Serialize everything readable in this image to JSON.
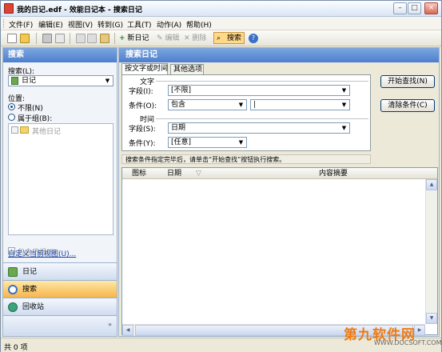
{
  "window": {
    "title": "我的日记.edf - 效能日记本 - 搜索日记"
  },
  "menu": [
    "文件(F)",
    "编辑(E)",
    "视图(V)",
    "转到(G)",
    "工具(T)",
    "动作(A)",
    "帮助(H)"
  ],
  "toolbar": {
    "new_diary": "新日记",
    "edit": "编辑",
    "delete": "删除",
    "search": "搜索"
  },
  "left": {
    "header": "搜索",
    "search_label": "搜索(L):",
    "search_value": "日记",
    "position_label": "位置:",
    "opt_unlimited": "不限(N)",
    "opt_group": "属于组(B):",
    "tree_item": "其他日记",
    "include_subgroups": "包含子组(S)",
    "customize_view": "自定义当前视图(U)...",
    "nav_diary": "日记",
    "nav_search": "搜索",
    "nav_recycle": "回收站"
  },
  "right": {
    "header": "搜索日记",
    "tab1": "按文字或时间",
    "tab2": "其他选项",
    "sec_text": "文字",
    "field_label": "字段(I):",
    "field_value": "[不限]",
    "cond_label": "条件(O):",
    "cond_value": "包含",
    "sec_time": "时间",
    "tfield_label": "字段(S):",
    "tfield_value": "日期",
    "tcond_label": "条件(Y):",
    "tcond_value": "[任意]",
    "start_btn": "开始查找(N)",
    "clear_btn": "清除条件(C)",
    "hint": "搜索条件指定完毕后，请单击“开始查找”按钮执行搜索。",
    "col_icon": "图标",
    "col_date": "日期",
    "col_summary": "内容摘要"
  },
  "status": {
    "count": "共 0 项"
  },
  "watermark": {
    "brand": "第九软件网",
    "url": "WWW.DOCSOFT.COM"
  },
  "colors": {
    "accent": "#4d7fcf",
    "selected_nav": "#f6b44d",
    "watermark": "#f07a10"
  }
}
